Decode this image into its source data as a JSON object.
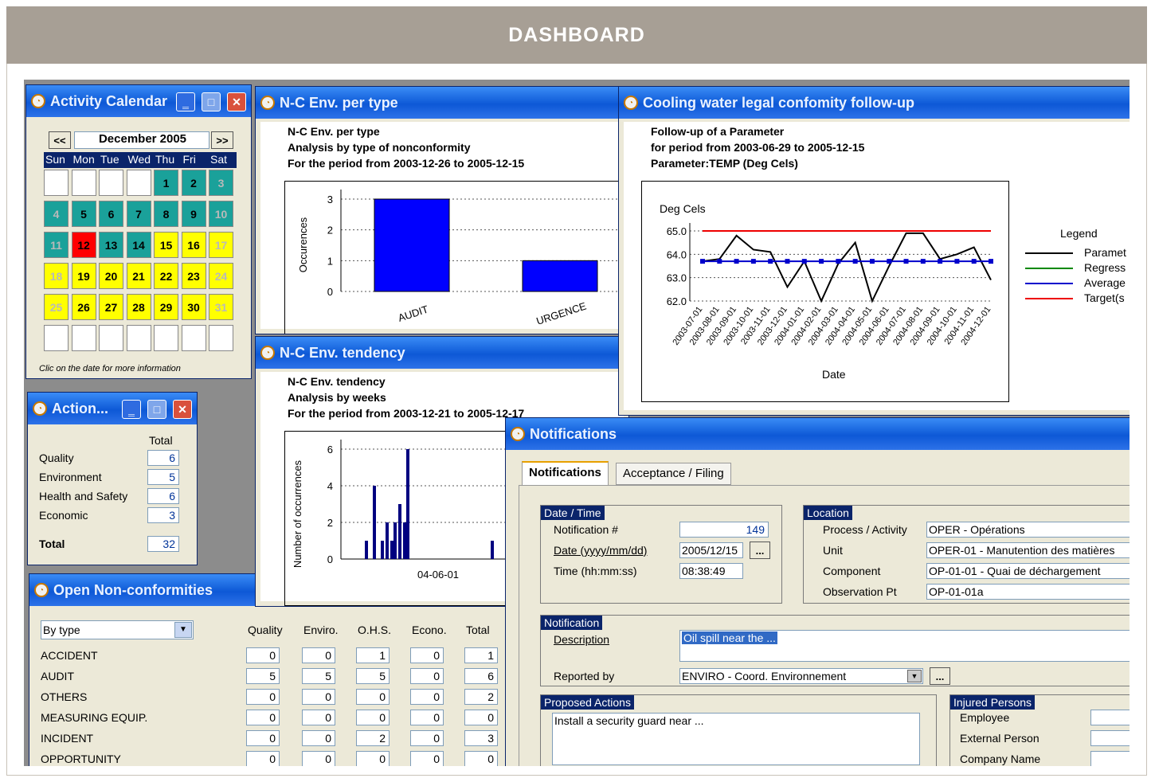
{
  "header": {
    "title": "DASHBOARD"
  },
  "calendar": {
    "title": "Activity Calendar",
    "prev": "<<",
    "next": ">>",
    "month": "December 2005",
    "weekdays": [
      "Sun",
      "Mon",
      "Tue",
      "Wed",
      "Thu",
      "Fri",
      "Sat"
    ],
    "days": [
      "1",
      "2",
      "3",
      "4",
      "5",
      "6",
      "7",
      "8",
      "9",
      "10",
      "11",
      "12",
      "13",
      "14",
      "15",
      "16",
      "17",
      "18",
      "19",
      "20",
      "21",
      "22",
      "23",
      "24",
      "25",
      "26",
      "27",
      "28",
      "29",
      "30",
      "31"
    ],
    "hint": "Clic on the date for more information"
  },
  "actions": {
    "title": "Action...",
    "col": "Total",
    "rows": [
      {
        "label": "Quality",
        "value": "6"
      },
      {
        "label": "Environment",
        "value": "5"
      },
      {
        "label": "Health and Safety",
        "value": "6"
      },
      {
        "label": "Economic",
        "value": "3"
      }
    ],
    "total_label": "Total",
    "total_value": "32"
  },
  "nctype": {
    "title": "N-C Env. per type",
    "line1": "N-C Env. per type",
    "line2": "Analysis by type of nonconformity",
    "line3": "For the period from 2003-12-26 to 2005-12-15",
    "ylabel": "Occurences",
    "yticks": [
      "3",
      "2",
      "1",
      "0"
    ]
  },
  "tendency": {
    "title": "N-C Env. tendency",
    "line1": "N-C Env. tendency",
    "line2": "Analysis by weeks",
    "line3": "For the period from 2003-12-21 to 2005-12-17",
    "ylabel": "Number of occurrences",
    "yticks": [
      "6",
      "4",
      "2",
      "0"
    ],
    "xtick": "04-06-01"
  },
  "cooling": {
    "title": "Cooling water legal confomity follow-up",
    "line1": "Follow-up of a Parameter",
    "line2": "for period from 2003-06-29 to 2005-12-15",
    "line3": "Parameter:TEMP (Deg Cels)",
    "ylabel": "Deg Cels",
    "yticks": [
      "65.0",
      "64.0",
      "63.0",
      "62.0"
    ],
    "xlabel": "Date",
    "legend_title": "Legend",
    "legend": [
      "Paramet",
      "Regress",
      "Average",
      "Target(s"
    ]
  },
  "opennc": {
    "title": "Open Non-conformities",
    "select": "By type",
    "headers": [
      "Quality",
      "Enviro.",
      "O.H.S.",
      "Econo.",
      "Total"
    ],
    "rows": [
      {
        "label": "ACCIDENT",
        "v": [
          "0",
          "0",
          "1",
          "0",
          "1"
        ]
      },
      {
        "label": "AUDIT",
        "v": [
          "5",
          "5",
          "5",
          "0",
          "6"
        ]
      },
      {
        "label": "OTHERS",
        "v": [
          "0",
          "0",
          "0",
          "0",
          "2"
        ]
      },
      {
        "label": "MEASURING EQUIP.",
        "v": [
          "0",
          "0",
          "0",
          "0",
          "0"
        ]
      },
      {
        "label": "INCIDENT",
        "v": [
          "0",
          "0",
          "2",
          "0",
          "3"
        ]
      },
      {
        "label": "OPPORTUNITY",
        "v": [
          "0",
          "0",
          "0",
          "0",
          "0"
        ]
      }
    ]
  },
  "notif": {
    "title": "Notifications",
    "tab1": "Notifications",
    "tab2": "Acceptance / Filing",
    "dt_head": "Date / Time",
    "num_label": "Notification #",
    "num_value": "149",
    "date_label": "Date (yyyy/mm/dd)",
    "date_value": "2005/12/15",
    "dots": "...",
    "time_label": "Time  (hh:mm:ss)",
    "time_value": "08:38:49",
    "loc_head": "Location",
    "proc_label": "Process / Activity",
    "proc_value": "OPER -  Opérations",
    "unit_label": "Unit",
    "unit_value": "OPER-01 - Manutention des matières",
    "comp_label": "Component",
    "comp_value": "OP-01-01 - Quai de déchargement",
    "obs_label": "Observation Pt",
    "obs_value": "OP-01-01a",
    "n_head": "Notification",
    "desc_label": "Description",
    "desc_value": "Oil spill near the ...",
    "rep_label": "Reported by",
    "rep_value": "ENVIRO - Coord. Environnement",
    "pa_head": "Proposed Actions",
    "pa_value": "Install a security guard near ...",
    "ip_head": "Injured Persons",
    "ip_emp": "Employee",
    "ip_ext": "External Person",
    "ip_comp": "Company Name"
  },
  "chart_data": [
    {
      "type": "bar",
      "title": "N-C Env. per type",
      "ylabel": "Occurences",
      "categories": [
        "AUDIT",
        "URGENCE"
      ],
      "values": [
        3,
        1
      ],
      "ylim": [
        0,
        3
      ]
    },
    {
      "type": "bar",
      "title": "N-C Env. tendency",
      "ylabel": "Number of occurrences",
      "values": [
        1,
        4,
        1,
        2,
        1,
        2,
        3,
        2,
        6,
        1
      ],
      "ylim": [
        0,
        6
      ]
    },
    {
      "type": "line",
      "title": "Follow-up of a Parameter",
      "ylabel": "Deg Cels",
      "xlabel": "Date",
      "x": [
        "2003-07-01",
        "2003-08-01",
        "2003-09-01",
        "2003-10-01",
        "2003-11-01",
        "2003-12-01",
        "2004-01-01",
        "2004-02-01",
        "2004-03-01",
        "2004-04-01",
        "2004-05-01",
        "2004-06-01",
        "2004-07-01",
        "2004-08-01",
        "2004-09-01",
        "2004-10-01",
        "2004-11-01",
        "2004-12-01"
      ],
      "series": [
        {
          "name": "Paramet",
          "values": [
            63.7,
            63.8,
            64.8,
            64.2,
            64.1,
            62.6,
            63.7,
            62.0,
            63.6,
            64.5,
            62.0,
            63.5,
            64.9,
            64.9,
            63.8,
            64.0,
            64.3,
            62.9
          ]
        },
        {
          "name": "Average",
          "values": [
            63.7,
            63.7,
            63.7,
            63.7,
            63.7,
            63.7,
            63.7,
            63.7,
            63.7,
            63.7,
            63.7,
            63.7,
            63.7,
            63.7,
            63.7,
            63.7,
            63.7,
            63.7
          ]
        },
        {
          "name": "Target(s",
          "values": [
            65.0,
            65.0,
            65.0,
            65.0,
            65.0,
            65.0,
            65.0,
            65.0,
            65.0,
            65.0,
            65.0,
            65.0,
            65.0,
            65.0,
            65.0,
            65.0,
            65.0,
            65.0
          ]
        }
      ],
      "ylim": [
        62.0,
        65.0
      ],
      "legend": "right"
    }
  ]
}
